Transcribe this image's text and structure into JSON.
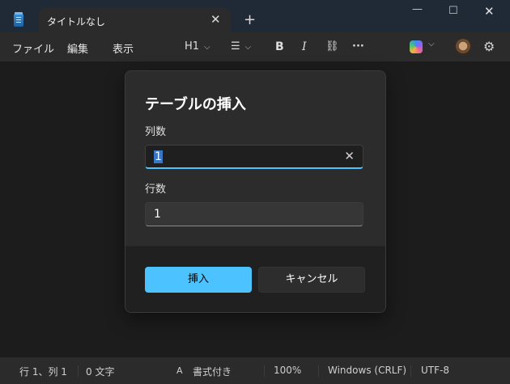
{
  "window": {
    "tab_title": "タイトルなし",
    "tab_close": "✕",
    "new_tab": "+",
    "minimize": "—",
    "maximize": "☐",
    "close": "✕"
  },
  "menu": {
    "file": "ファイル",
    "edit": "編集",
    "view": "表示"
  },
  "toolbar": {
    "heading": "H1",
    "list_icon": "☰",
    "bold": "B",
    "italic": "I",
    "link_icon": "⛓",
    "more": "···",
    "chevron": "⌵",
    "gear": "⚙"
  },
  "dialog": {
    "title": "テーブルの挿入",
    "columns_label": "列数",
    "columns_value": "1",
    "clear_icon": "✕",
    "rows_label": "行数",
    "rows_value": "1",
    "insert_button": "挿入",
    "cancel_button": "キャンセル"
  },
  "status": {
    "position": "行 1、列 1",
    "chars": "0 文字",
    "format_icon": "A",
    "format": "書式付き",
    "zoom": "100%",
    "line_ending": "Windows (CRLF)",
    "encoding": "UTF-8"
  },
  "colors": {
    "accent": "#4cc2ff",
    "dialog_bg": "#2c2c2c",
    "titlebar_bg": "#202a36"
  }
}
